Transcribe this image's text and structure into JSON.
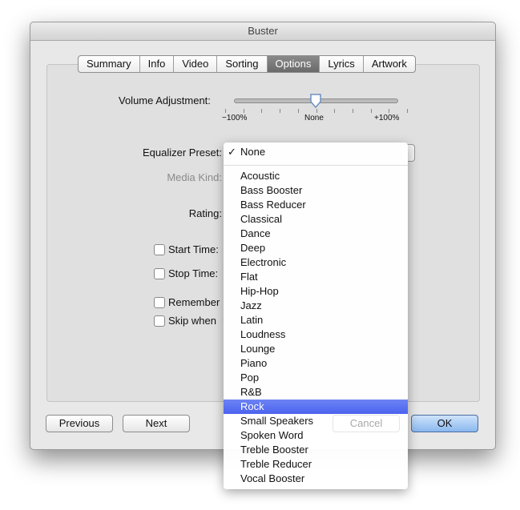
{
  "window": {
    "title": "Buster"
  },
  "tabs": [
    {
      "label": "Summary"
    },
    {
      "label": "Info"
    },
    {
      "label": "Video"
    },
    {
      "label": "Sorting"
    },
    {
      "label": "Options",
      "selected": true
    },
    {
      "label": "Lyrics"
    },
    {
      "label": "Artwork"
    }
  ],
  "options": {
    "volume_label": "Volume Adjustment:",
    "volume_min": "−100%",
    "volume_mid": "None",
    "volume_max": "+100%",
    "volume_value_percent": 0,
    "eq_label": "Equalizer Preset:",
    "media_kind_label": "Media Kind:",
    "rating_label": "Rating:",
    "start_time_label": "Start Time:",
    "stop_time_label": "Stop Time:",
    "remember_label": "Remember",
    "skip_label": "Skip when"
  },
  "buttons": {
    "previous": "Previous",
    "next": "Next",
    "cancel": "Cancel",
    "ok": "OK"
  },
  "menu": {
    "checked": "None",
    "check_mark": "✓",
    "items": [
      "Acoustic",
      "Bass Booster",
      "Bass Reducer",
      "Classical",
      "Dance",
      "Deep",
      "Electronic",
      "Flat",
      "Hip-Hop",
      "Jazz",
      "Latin",
      "Loudness",
      "Lounge",
      "Piano",
      "Pop",
      "R&B",
      "Rock",
      "Small Speakers",
      "Spoken Word",
      "Treble Booster",
      "Treble Reducer",
      "Vocal Booster"
    ],
    "highlighted": "Rock"
  }
}
